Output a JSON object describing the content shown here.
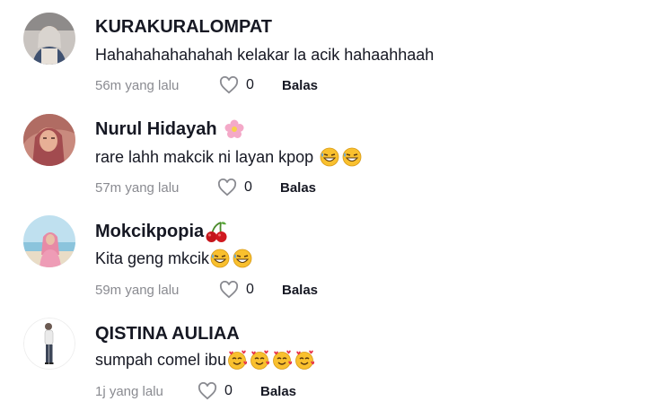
{
  "comments": [
    {
      "username": "KURAKURALOMPAT",
      "text": "Hahahahahahahah kelakar la acik hahaahhaah",
      "time": "56m yang lalu",
      "likes": "0",
      "reply": "Balas",
      "name_icon": "",
      "text_icons": []
    },
    {
      "username": "Nurul Hidayah",
      "text": "rare lahh makcik ni layan kpop",
      "time": "57m yang lalu",
      "likes": "0",
      "reply": "Balas",
      "name_icon": "pink-flower-icon",
      "text_icons": [
        "grinning-sweat-icon",
        "grinning-sweat-icon"
      ]
    },
    {
      "username": "Mokcikpopia",
      "text": "Kita geng mkcik",
      "time": "59m yang lalu",
      "likes": "0",
      "reply": "Balas",
      "name_icon": "cherries-icon",
      "text_icons": [
        "grinning-sweat-icon",
        "grinning-sweat-icon"
      ]
    },
    {
      "username": "QISTINA AULIAA",
      "text": "sumpah comel ibu",
      "time": "1j yang lalu",
      "likes": "0",
      "reply": "Balas",
      "name_icon": "",
      "text_icons": [
        "smiling-hearts-icon",
        "smiling-hearts-icon",
        "smiling-hearts-icon",
        "smiling-hearts-icon"
      ]
    }
  ]
}
